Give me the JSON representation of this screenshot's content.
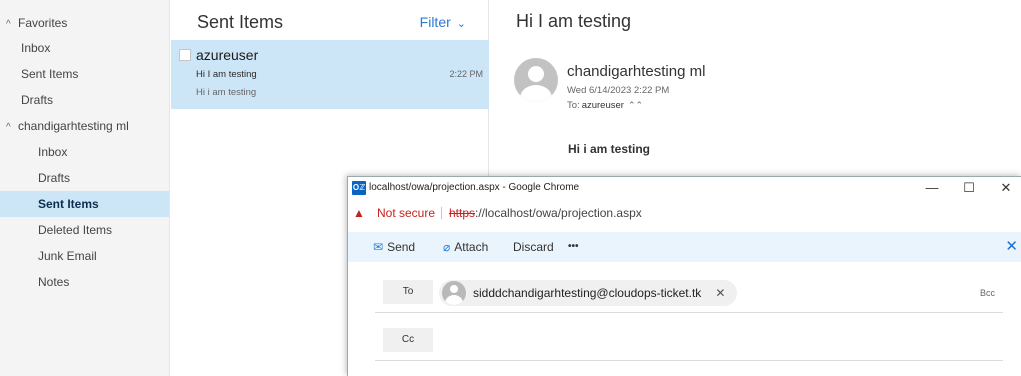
{
  "nav": {
    "favorites_label": "Favorites",
    "favorites_items": [
      "Inbox",
      "Sent Items",
      "Drafts"
    ],
    "account_label": "chandigarhtesting ml",
    "account_items": [
      "Inbox",
      "Drafts",
      "Sent Items",
      "Deleted Items",
      "Junk Email",
      "Notes"
    ],
    "selected_item": "Sent Items",
    "chevron": "^"
  },
  "message_list": {
    "title": "Sent Items",
    "filter_label": "Filter",
    "filter_caret": "⌄",
    "messages": [
      {
        "sender": "azureuser",
        "subject": "Hi I am testing",
        "time": "2:22 PM",
        "preview": "Hi i am testing"
      }
    ]
  },
  "reading_pane": {
    "subject": "Hi I am testing",
    "from": "chandigarhtesting ml",
    "date": "Wed 6/14/2023 2:22 PM",
    "to_label": "To:",
    "to_name": "azureuser",
    "to_toggle": "⌃⌃",
    "body": "Hi i am testing"
  },
  "popup": {
    "app_icon_text": "Oℤ",
    "window_title": "localhost/owa/projection.aspx - Google Chrome",
    "minimize": "—",
    "maximize": "☐",
    "close": "✕",
    "warning_icon": "▲",
    "not_secure": "Not secure",
    "url_scheme": "https",
    "url_rest": "://localhost/owa/projection.aspx",
    "commands": {
      "send": "Send",
      "attach": "Attach",
      "discard": "Discard",
      "more": "•••",
      "close": "✕"
    },
    "to_button": "To",
    "to_recipient": "sidddchandigarhtesting@cloudops-ticket.tk",
    "remove_recipient": "✕",
    "bcc": "Bcc",
    "cc_button": "Cc"
  },
  "colors": {
    "selection": "#cde6f7",
    "accent": "#2a7ad5",
    "warning": "#c5221f"
  }
}
